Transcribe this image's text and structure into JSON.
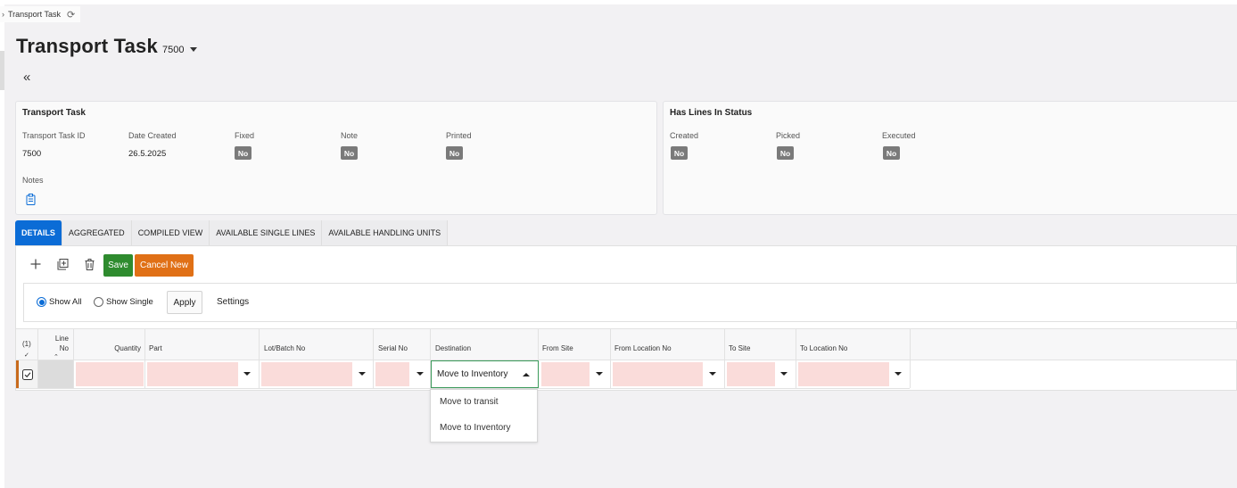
{
  "breadcrumb": {
    "label": "Transport Task"
  },
  "header": {
    "title": "Transport Task",
    "record_id": "7500"
  },
  "general": {
    "title": "Transport Task",
    "fields": {
      "transport_task_id": {
        "label": "Transport Task ID",
        "value": "7500"
      },
      "date_created": {
        "label": "Date Created",
        "value": "26.5.2025"
      },
      "fixed": {
        "label": "Fixed",
        "value": "No"
      },
      "note": {
        "label": "Note",
        "value": "No"
      },
      "printed": {
        "label": "Printed",
        "value": "No"
      },
      "notes": {
        "label": "Notes"
      }
    }
  },
  "status": {
    "title": "Has Lines In Status",
    "fields": {
      "created": {
        "label": "Created",
        "value": "No"
      },
      "picked": {
        "label": "Picked",
        "value": "No"
      },
      "executed": {
        "label": "Executed",
        "value": "No"
      }
    }
  },
  "tabs": [
    {
      "label": "DETAILS",
      "active": true
    },
    {
      "label": "AGGREGATED"
    },
    {
      "label": "COMPILED VIEW"
    },
    {
      "label": "AVAILABLE SINGLE LINES"
    },
    {
      "label": "AVAILABLE HANDLING UNITS"
    }
  ],
  "toolbar": {
    "save_label": "Save",
    "cancel_label": "Cancel New"
  },
  "filter": {
    "show_all": "Show All",
    "show_single": "Show Single",
    "selected": "Show All",
    "apply": "Apply",
    "settings": "Settings"
  },
  "grid": {
    "selection_count": "(1)",
    "columns": {
      "line_no": "Line No",
      "quantity": "Quantity",
      "part": "Part",
      "lot_batch_no": "Lot/Batch No",
      "serial_no": "Serial No",
      "destination": "Destination",
      "from_site": "From Site",
      "from_location_no": "From Location No",
      "to_site": "To Site",
      "to_location_no": "To Location No"
    },
    "row": {
      "destination_value": "Move to Inventory"
    }
  },
  "destination_options": [
    "Move to transit",
    "Move to Inventory"
  ],
  "colors": {
    "accent": "#0b6cd6",
    "save": "#2e8b2e",
    "cancel": "#e07016",
    "required_field": "#fadcda",
    "badge": "#7a7a7a"
  }
}
